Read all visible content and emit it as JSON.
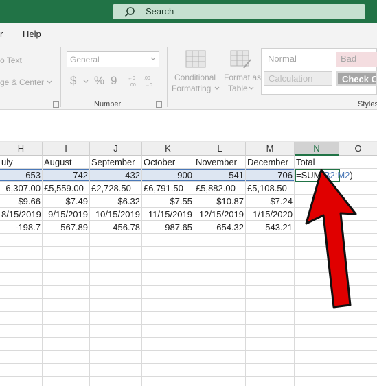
{
  "search": {
    "label": "Search"
  },
  "menu": {
    "partial_left": "r",
    "help": "Help"
  },
  "ribbon": {
    "wrap_text_partial": "o Text",
    "merge_partial": "ge & Center",
    "number_format": "General",
    "currency_symbol": "$",
    "percent_symbol": "%",
    "comma_symbol": "9",
    "number_group_label": "Number",
    "conditional_formatting_1": "Conditional",
    "conditional_formatting_2": "Formatting",
    "format_as_table_1": "Format as",
    "format_as_table_2": "Table",
    "styles_group_label": "Styles",
    "style_normal": "Normal",
    "style_bad": "Bad",
    "style_calculation": "Calculation",
    "style_check_cell": "Check Ce"
  },
  "columns": [
    "H",
    "I",
    "J",
    "K",
    "L",
    "M",
    "N",
    "O"
  ],
  "selected_column": "N",
  "rows": [
    [
      "uly",
      "August",
      "September",
      "October",
      "November",
      "December",
      "Total"
    ],
    [
      "653",
      "742",
      "432",
      "900",
      "541",
      "706",
      ""
    ],
    [
      "6,307.00",
      "£5,559.00",
      "£2,728.50",
      "£6,791.50",
      "£5,882.00",
      "£5,108.50",
      ""
    ],
    [
      "$9.66",
      "$7.49",
      "$6.32",
      "$7.55",
      "$10.87",
      "$7.24",
      ""
    ],
    [
      "8/15/2019",
      "9/15/2019",
      "10/15/2019",
      "11/15/2019",
      "12/15/2019",
      "1/15/2020",
      ""
    ],
    [
      "-198.7",
      "567.89",
      "456.78",
      "987.65",
      "654.32",
      "543.21",
      ""
    ]
  ],
  "formula": {
    "prefix": "=SUM(",
    "range": "B2:M2",
    "suffix": ")"
  },
  "colors": {
    "excel_green": "#217346",
    "arrow_red": "#e00000",
    "selection_blue": "#4a78b8"
  }
}
